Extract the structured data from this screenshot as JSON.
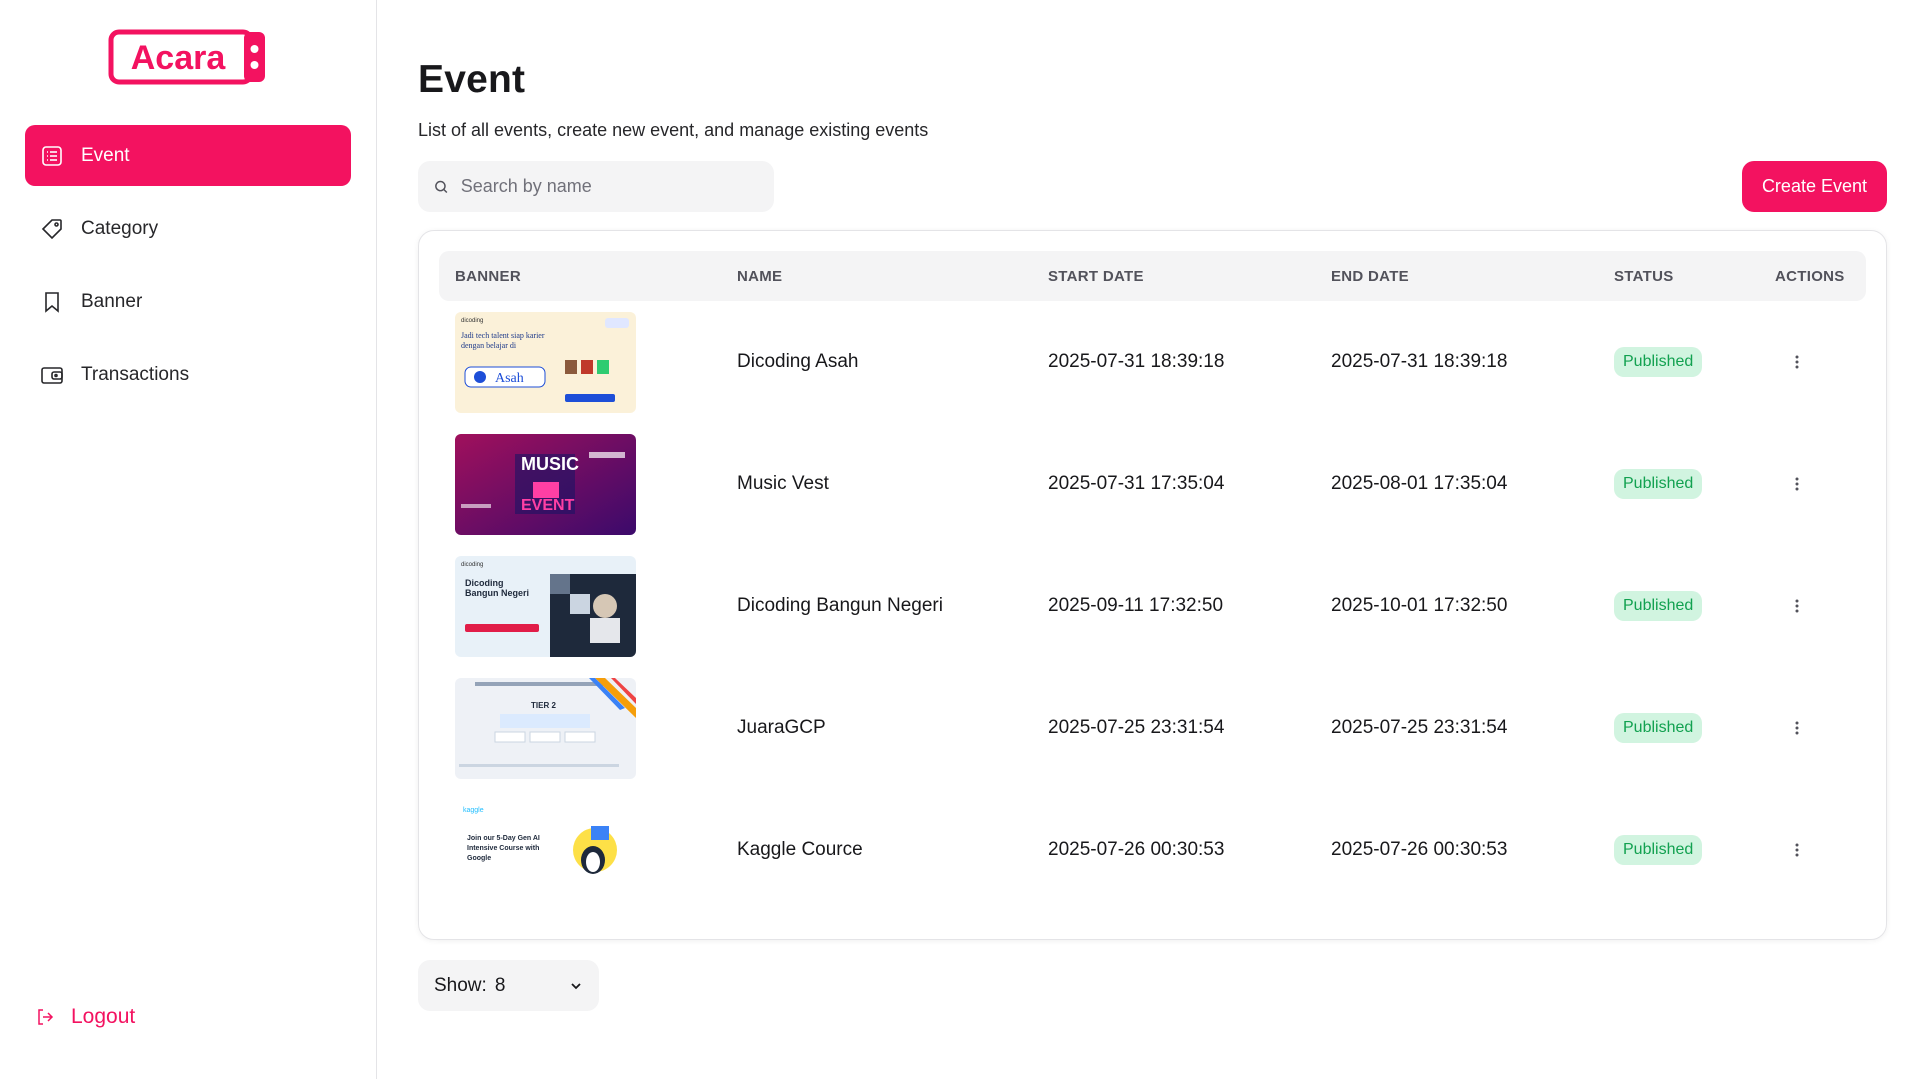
{
  "brand": {
    "name": "Acara",
    "accent": "#f31260"
  },
  "sidebar": {
    "items": [
      {
        "label": "Event",
        "icon": "list-icon",
        "active": true
      },
      {
        "label": "Category",
        "icon": "tag-icon",
        "active": false
      },
      {
        "label": "Banner",
        "icon": "bookmark-icon",
        "active": false
      },
      {
        "label": "Transactions",
        "icon": "wallet-icon",
        "active": false
      }
    ],
    "logout_label": "Logout"
  },
  "page": {
    "title": "Event",
    "subtitle": "List of all events, create new event, and manage existing events"
  },
  "search": {
    "placeholder": "Search by name",
    "value": ""
  },
  "toolbar": {
    "create_label": "Create Event"
  },
  "table": {
    "columns": [
      "BANNER",
      "NAME",
      "START DATE",
      "END DATE",
      "STATUS",
      "ACTIONS"
    ],
    "rows": [
      {
        "name": "Dicoding Asah",
        "start": "2025-07-31 18:39:18",
        "end": "2025-07-31 18:39:18",
        "status": "Published",
        "banner": "banner-asah"
      },
      {
        "name": "Music Vest",
        "start": "2025-07-31 17:35:04",
        "end": "2025-08-01 17:35:04",
        "status": "Published",
        "banner": "banner-music"
      },
      {
        "name": "Dicoding Bangun Negeri",
        "start": "2025-09-11 17:32:50",
        "end": "2025-10-01 17:32:50",
        "status": "Published",
        "banner": "banner-bangun-negeri"
      },
      {
        "name": "JuaraGCP",
        "start": "2025-07-25 23:31:54",
        "end": "2025-07-25 23:31:54",
        "status": "Published",
        "banner": "banner-juaragcp"
      },
      {
        "name": "Kaggle Cource",
        "start": "2025-07-26 00:30:53",
        "end": "2025-07-26 00:30:53",
        "status": "Published",
        "banner": "banner-kaggle"
      }
    ]
  },
  "pagination": {
    "show_label": "Show:",
    "show_value": "8"
  }
}
